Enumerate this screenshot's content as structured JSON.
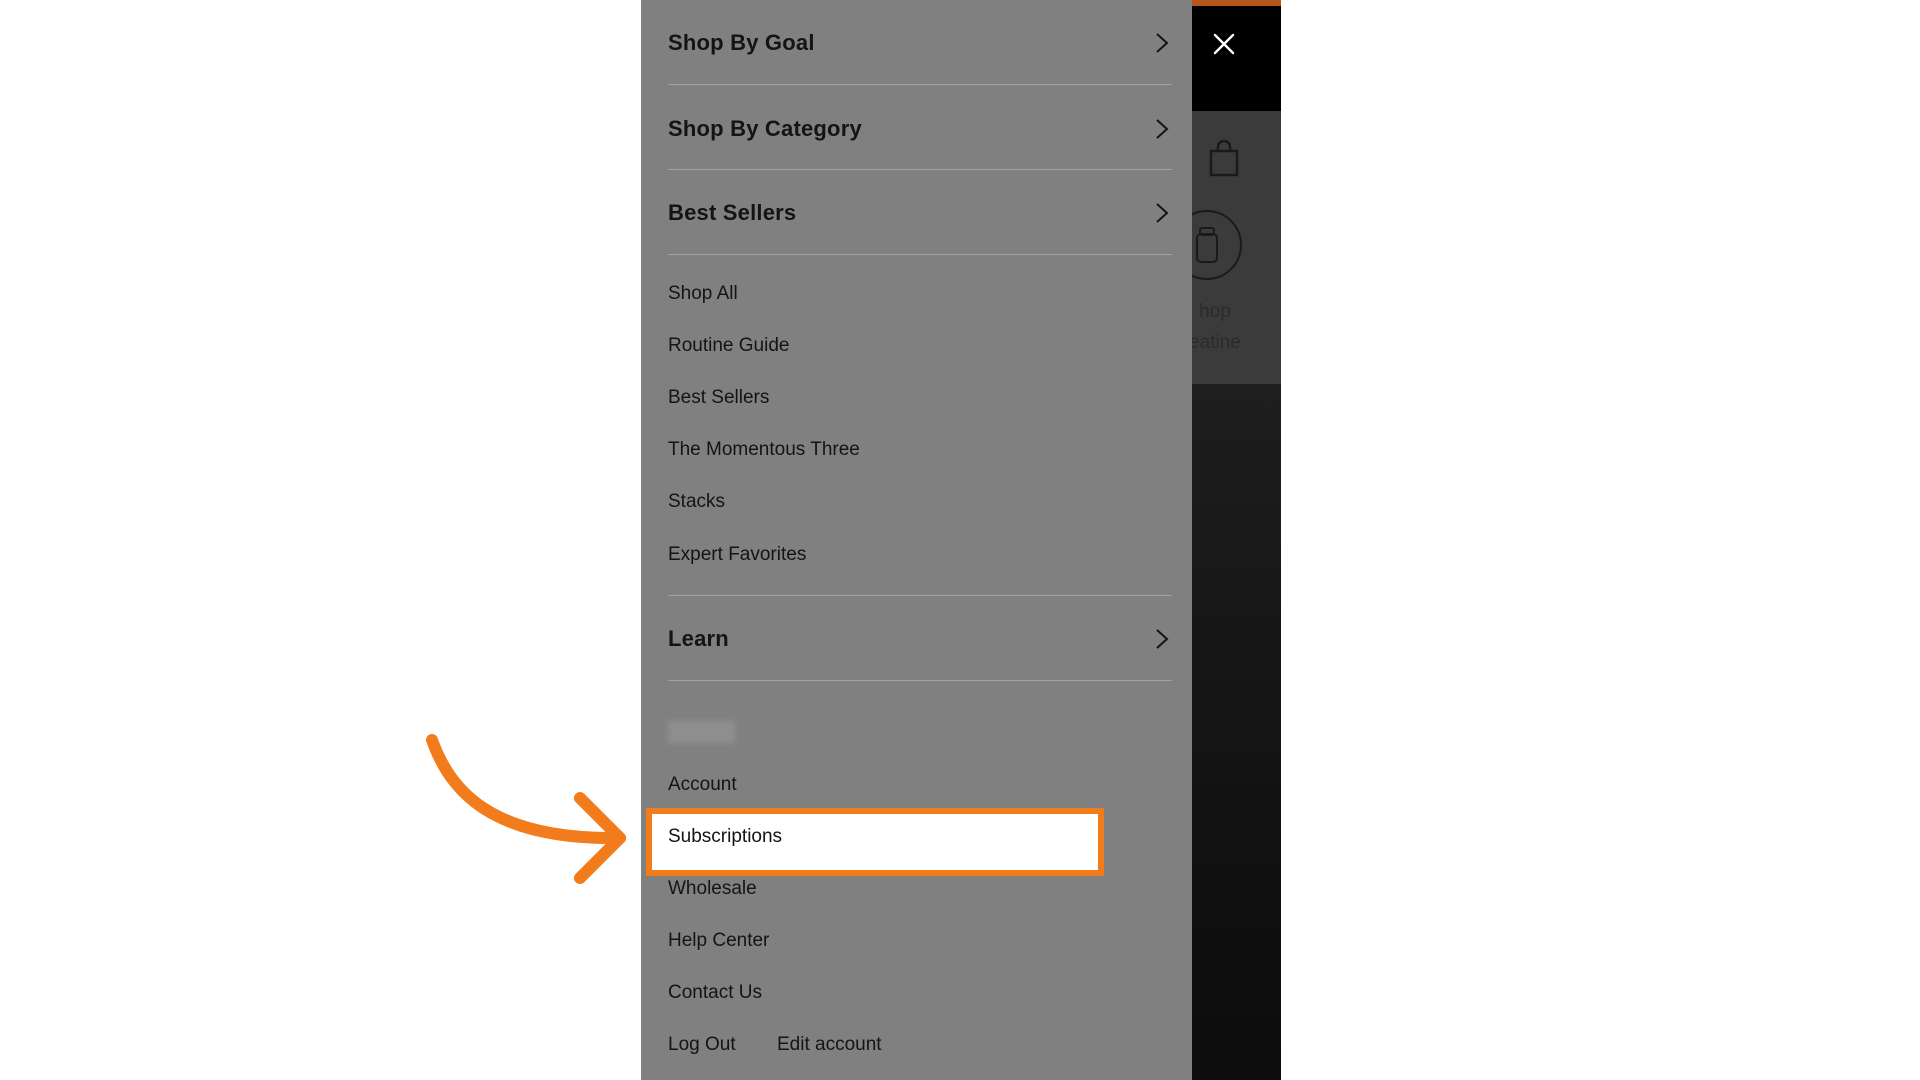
{
  "drawer": {
    "categories": [
      {
        "label": "Shop By Goal"
      },
      {
        "label": "Shop By Category"
      },
      {
        "label": "Best Sellers"
      }
    ],
    "links": [
      {
        "label": "Shop All"
      },
      {
        "label": "Routine Guide"
      },
      {
        "label": "Best Sellers"
      },
      {
        "label": "The Momentous Three"
      },
      {
        "label": "Stacks"
      },
      {
        "label": "Expert Favorites"
      }
    ],
    "learn": {
      "label": "Learn"
    },
    "account_links": {
      "account": "Account",
      "subscriptions": "Subscriptions",
      "wholesale": "Wholesale",
      "help_center": "Help Center",
      "contact_us": "Contact Us",
      "log_out": "Log Out",
      "edit_account": "Edit account"
    }
  },
  "background": {
    "shop_label_line1": "hop",
    "shop_label_line2": "eatine"
  },
  "annotation": {
    "highlight_color": "#f27c1c",
    "arrow_color": "#f27c1c"
  },
  "icons": {
    "close": "close-icon",
    "cart": "shopping-bag-icon",
    "chevron": "chevron-right-icon",
    "arrow": "curved-arrow-icon"
  }
}
